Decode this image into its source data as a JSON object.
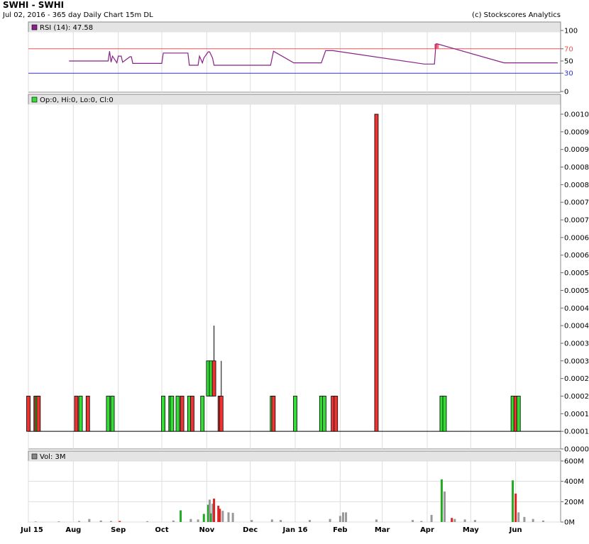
{
  "header": {
    "title": "SWHI - SWHI",
    "subtitle": "Jul 02, 2016 - 365 day  Daily Chart 15m DL",
    "copyright": "(c) Stockscores Analytics"
  },
  "colors": {
    "up": "#33dd33",
    "down": "#ee3333",
    "rsi_line": "#882288",
    "rsi_70": "#ee5555",
    "rsi_30": "#3333cc",
    "volume_gray": "#999999",
    "volume_green": "#22aa22",
    "volume_red": "#dd2222",
    "panel_header": "#e4e4e4",
    "grid": "#dddddd"
  },
  "chart_data": [
    {
      "type": "line",
      "panel": "rsi",
      "legend": "RSI (14): 47.58",
      "ylim": [
        0,
        100
      ],
      "yticks": [
        0,
        30,
        50,
        70,
        100
      ],
      "reference_lines": [
        70,
        30
      ],
      "x": [
        "2015-07-29",
        "2015-08-25",
        "2015-08-26",
        "2015-08-27",
        "2015-08-28",
        "2015-08-31",
        "2015-09-01",
        "2015-09-03",
        "2015-09-04",
        "2015-09-09",
        "2015-09-10",
        "2015-09-11",
        "2015-09-14",
        "2015-10-01",
        "2015-10-02",
        "2015-10-19",
        "2015-10-20",
        "2015-10-26",
        "2015-10-27",
        "2015-10-29",
        "2015-10-30",
        "2015-11-02",
        "2015-11-03",
        "2015-11-05",
        "2015-11-06",
        "2015-11-09",
        "2015-11-10",
        "2015-12-15",
        "2015-12-17",
        "2015-12-31",
        "2016-01-01",
        "2016-01-19",
        "2016-01-22",
        "2016-01-27",
        "2016-03-30",
        "2016-04-01",
        "2016-04-04",
        "2016-04-06",
        "2016-04-07",
        "2016-04-08",
        "2016-05-24",
        "2016-05-26",
        "2016-05-27",
        "2016-06-30"
      ],
      "values": [
        50,
        50,
        66,
        48,
        58,
        47,
        58,
        58,
        48,
        57,
        57,
        46,
        46,
        46,
        63,
        63,
        43,
        43,
        58,
        47,
        55,
        65,
        65,
        55,
        43,
        43,
        43,
        43,
        66,
        47,
        47,
        47,
        67,
        67,
        45,
        45,
        45,
        45,
        78,
        78,
        47,
        47,
        47,
        47
      ],
      "xlabels": [
        "Jul 15",
        "Aug",
        "Sep",
        "Oct",
        "Nov",
        "Dec",
        "Jan 16",
        "Feb",
        "Mar",
        "Apr",
        "May",
        "Jun"
      ]
    },
    {
      "type": "bar",
      "panel": "price",
      "legend": "Op:0, Hi:0, Lo:0, Cl:0",
      "ylim": [
        5e-05,
        0.001
      ],
      "yticks": [
        5e-05,
        0.0001,
        0.00015,
        0.0002,
        0.00025,
        0.0003,
        0.00035,
        0.0004,
        0.00045,
        0.0005,
        0.00055,
        0.0006,
        0.00065,
        0.0007,
        0.00075,
        0.0008,
        0.00085,
        0.0009,
        0.00095,
        0.001
      ],
      "candles": [
        {
          "date": "2015-07-01",
          "open": 0.0002,
          "high": 0.0002,
          "low": 0.0001,
          "close": 0.0001
        },
        {
          "date": "2015-07-06",
          "open": 0.0002,
          "high": 0.0002,
          "low": 0.0001,
          "close": 0.0001
        },
        {
          "date": "2015-07-07",
          "open": 0.0001,
          "high": 0.0002,
          "low": 0.0001,
          "close": 0.0002
        },
        {
          "date": "2015-07-08",
          "open": 0.0002,
          "high": 0.0002,
          "low": 0.0001,
          "close": 0.0001
        },
        {
          "date": "2015-08-03",
          "open": 0.0002,
          "high": 0.0002,
          "low": 0.0001,
          "close": 0.0001
        },
        {
          "date": "2015-08-06",
          "open": 0.0001,
          "high": 0.0002,
          "low": 0.0001,
          "close": 0.0002
        },
        {
          "date": "2015-08-11",
          "open": 0.0002,
          "high": 0.0002,
          "low": 0.0001,
          "close": 0.0001
        },
        {
          "date": "2015-08-25",
          "open": 0.0001,
          "high": 0.0002,
          "low": 0.0001,
          "close": 0.0002
        },
        {
          "date": "2015-08-28",
          "open": 0.0001,
          "high": 0.0002,
          "low": 0.0001,
          "close": 0.0002
        },
        {
          "date": "2015-10-02",
          "open": 0.0001,
          "high": 0.0002,
          "low": 0.0001,
          "close": 0.0002
        },
        {
          "date": "2015-10-07",
          "open": 0.0001,
          "high": 0.0002,
          "low": 0.0001,
          "close": 0.0002
        },
        {
          "date": "2015-10-08",
          "open": 0.0001,
          "high": 0.0002,
          "low": 0.0001,
          "close": 0.0002
        },
        {
          "date": "2015-10-12",
          "open": 0.0001,
          "high": 0.0002,
          "low": 0.0001,
          "close": 0.0002
        },
        {
          "date": "2015-10-15",
          "open": 0.0002,
          "high": 0.0002,
          "low": 0.0001,
          "close": 0.0001
        },
        {
          "date": "2015-10-20",
          "open": 0.0001,
          "high": 0.0002,
          "low": 0.0001,
          "close": 0.0002
        },
        {
          "date": "2015-10-22",
          "open": 0.0002,
          "high": 0.0002,
          "low": 0.0001,
          "close": 0.0001
        },
        {
          "date": "2015-10-29",
          "open": 0.0001,
          "high": 0.0002,
          "low": 0.0001,
          "close": 0.0002
        },
        {
          "date": "2015-11-02",
          "open": 0.0002,
          "high": 0.0003,
          "low": 0.0002,
          "close": 0.0003
        },
        {
          "date": "2015-11-04",
          "open": 0.0002,
          "high": 0.0003,
          "low": 0.0002,
          "close": 0.0003
        },
        {
          "date": "2015-11-06",
          "open": 0.0003,
          "high": 0.0004,
          "low": 0.0002,
          "close": 0.0002
        },
        {
          "date": "2015-11-10",
          "open": 0.0002,
          "high": 0.0002,
          "low": 0.0001,
          "close": 0.0001
        },
        {
          "date": "2015-11-11",
          "open": 0.0002,
          "high": 0.0003,
          "low": 0.0001,
          "close": 0.0001
        },
        {
          "date": "2015-12-16",
          "open": 0.0001,
          "high": 0.0002,
          "low": 0.0001,
          "close": 0.0002
        },
        {
          "date": "2015-12-17",
          "open": 0.0002,
          "high": 0.0002,
          "low": 0.0001,
          "close": 0.0001
        },
        {
          "date": "2016-01-01",
          "open": 0.0001,
          "high": 0.0002,
          "low": 0.0001,
          "close": 0.0002
        },
        {
          "date": "2016-01-19",
          "open": 0.0001,
          "high": 0.0002,
          "low": 0.0001,
          "close": 0.0002
        },
        {
          "date": "2016-01-21",
          "open": 0.0001,
          "high": 0.0002,
          "low": 0.0001,
          "close": 0.0002
        },
        {
          "date": "2016-01-27",
          "open": 0.0002,
          "high": 0.0002,
          "low": 0.0001,
          "close": 0.0001
        },
        {
          "date": "2016-01-29",
          "open": 0.0002,
          "high": 0.0002,
          "low": 0.0001,
          "close": 0.0001
        },
        {
          "date": "2016-02-26",
          "open": 0.001,
          "high": 0.001,
          "low": 0.0001,
          "close": 0.0001
        },
        {
          "date": "2016-04-11",
          "open": 0.0001,
          "high": 0.0002,
          "low": 0.0001,
          "close": 0.0002
        },
        {
          "date": "2016-04-13",
          "open": 0.0001,
          "high": 0.0002,
          "low": 0.0001,
          "close": 0.0002
        },
        {
          "date": "2016-05-30",
          "open": 0.0001,
          "high": 0.0002,
          "low": 0.0001,
          "close": 0.0002
        },
        {
          "date": "2016-06-01",
          "open": 0.0002,
          "high": 0.0002,
          "low": 0.0001,
          "close": 0.0001
        },
        {
          "date": "2016-06-03",
          "open": 0.0001,
          "high": 0.0002,
          "low": 0.0001,
          "close": 0.0002
        }
      ]
    },
    {
      "type": "bar",
      "panel": "volume",
      "legend": "Vol: 3M",
      "ylim": [
        0,
        600
      ],
      "yticks": [
        0,
        200,
        400,
        600
      ],
      "ytick_labels": [
        "0M",
        "200M",
        "400M",
        "600M"
      ],
      "bars": [
        {
          "date": "2015-07-06",
          "value": 5,
          "color": "gray"
        },
        {
          "date": "2015-07-22",
          "value": 6,
          "color": "gray"
        },
        {
          "date": "2015-08-05",
          "value": 10,
          "color": "gray"
        },
        {
          "date": "2015-08-12",
          "value": 30,
          "color": "gray"
        },
        {
          "date": "2015-08-20",
          "value": 15,
          "color": "gray"
        },
        {
          "date": "2015-08-27",
          "value": 10,
          "color": "gray"
        },
        {
          "date": "2015-09-02",
          "value": 10,
          "color": "red"
        },
        {
          "date": "2015-09-21",
          "value": 8,
          "color": "gray"
        },
        {
          "date": "2015-10-09",
          "value": 15,
          "color": "gray"
        },
        {
          "date": "2015-10-14",
          "value": 115,
          "color": "green"
        },
        {
          "date": "2015-10-21",
          "value": 30,
          "color": "gray"
        },
        {
          "date": "2015-10-26",
          "value": 25,
          "color": "gray"
        },
        {
          "date": "2015-10-30",
          "value": 80,
          "color": "green"
        },
        {
          "date": "2015-11-02",
          "value": 170,
          "color": "green"
        },
        {
          "date": "2015-11-03",
          "value": 220,
          "color": "gray"
        },
        {
          "date": "2015-11-04",
          "value": 85,
          "color": "green"
        },
        {
          "date": "2015-11-05",
          "value": 180,
          "color": "gray"
        },
        {
          "date": "2015-11-06",
          "value": 230,
          "color": "red"
        },
        {
          "date": "2015-11-09",
          "value": 160,
          "color": "red"
        },
        {
          "date": "2015-11-10",
          "value": 130,
          "color": "red"
        },
        {
          "date": "2015-11-12",
          "value": 110,
          "color": "gray"
        },
        {
          "date": "2015-11-16",
          "value": 95,
          "color": "gray"
        },
        {
          "date": "2015-11-19",
          "value": 90,
          "color": "gray"
        },
        {
          "date": "2015-12-02",
          "value": 20,
          "color": "gray"
        },
        {
          "date": "2015-12-16",
          "value": 25,
          "color": "gray"
        },
        {
          "date": "2015-12-22",
          "value": 20,
          "color": "gray"
        },
        {
          "date": "2016-01-11",
          "value": 20,
          "color": "gray"
        },
        {
          "date": "2016-01-25",
          "value": 30,
          "color": "gray"
        },
        {
          "date": "2016-02-01",
          "value": 60,
          "color": "gray"
        },
        {
          "date": "2016-02-03",
          "value": 95,
          "color": "gray"
        },
        {
          "date": "2016-02-05",
          "value": 95,
          "color": "gray"
        },
        {
          "date": "2016-02-26",
          "value": 25,
          "color": "gray"
        },
        {
          "date": "2016-03-22",
          "value": 20,
          "color": "gray"
        },
        {
          "date": "2016-03-28",
          "value": 10,
          "color": "gray"
        },
        {
          "date": "2016-04-04",
          "value": 70,
          "color": "gray"
        },
        {
          "date": "2016-04-11",
          "value": 420,
          "color": "green"
        },
        {
          "date": "2016-04-13",
          "value": 300,
          "color": "gray"
        },
        {
          "date": "2016-04-18",
          "value": 40,
          "color": "red"
        },
        {
          "date": "2016-04-20",
          "value": 30,
          "color": "gray"
        },
        {
          "date": "2016-04-27",
          "value": 25,
          "color": "gray"
        },
        {
          "date": "2016-05-04",
          "value": 20,
          "color": "gray"
        },
        {
          "date": "2016-05-30",
          "value": 410,
          "color": "green"
        },
        {
          "date": "2016-06-01",
          "value": 280,
          "color": "red"
        },
        {
          "date": "2016-06-03",
          "value": 95,
          "color": "gray"
        },
        {
          "date": "2016-06-07",
          "value": 50,
          "color": "gray"
        },
        {
          "date": "2016-06-13",
          "value": 30,
          "color": "gray"
        },
        {
          "date": "2016-06-20",
          "value": 15,
          "color": "gray"
        }
      ]
    }
  ]
}
